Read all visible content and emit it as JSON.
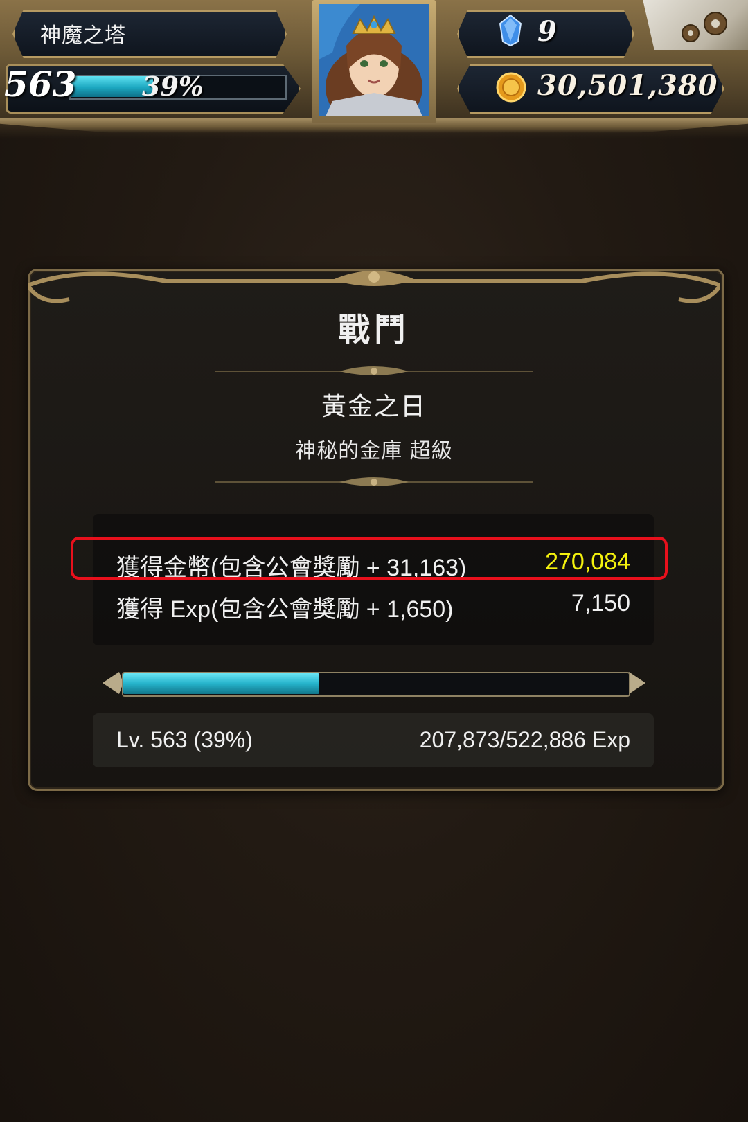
{
  "hud": {
    "tower_name": "神魔之塔",
    "level": "563",
    "exp_percent_label": "39%",
    "exp_fraction": 0.39,
    "gem_count": "9",
    "coin_count": "30,501,380"
  },
  "result": {
    "title": "戰鬥",
    "stage_name": "黃金之日",
    "stage_detail": "神秘的金庫 超級",
    "gold_label": "獲得金幣(包含公會獎勵 + 31,163)",
    "gold_value": "270,084",
    "exp_label": "獲得 Exp(包含公會獎勵 + 1,650)",
    "exp_value": "7,150",
    "level_text": "Lv. 563 (39%)",
    "exp_progress_text": "207,873/522,886 Exp",
    "exp_fraction": 0.39
  },
  "colors": {
    "gold_value": "#f4f20e",
    "highlight": "#e8101c",
    "exp_bar": "#25b3cb"
  },
  "icons": [
    "gem-icon",
    "coin-icon",
    "gear-icon",
    "character-portrait"
  ]
}
